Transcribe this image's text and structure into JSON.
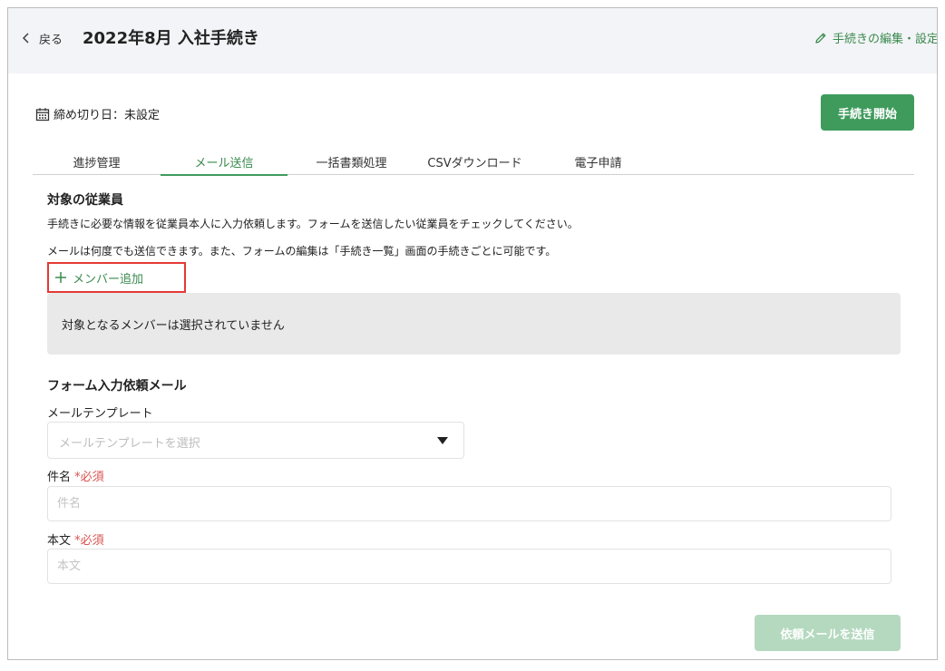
{
  "header": {
    "back_label": "戻る",
    "title": "2022年8月 入社手続き",
    "edit_link_label": "手続きの編集・設定"
  },
  "deadline": {
    "label": "締め切り日：未設定"
  },
  "start_button_label": "手続き開始",
  "tabs": [
    {
      "label": "進捗管理",
      "active": false
    },
    {
      "label": "メール送信",
      "active": true
    },
    {
      "label": "一括書類処理",
      "active": false
    },
    {
      "label": "CSVダウンロード",
      "active": false
    },
    {
      "label": "電子申請",
      "active": false
    }
  ],
  "employees": {
    "title": "対象の従業員",
    "desc1": "手続きに必要な情報を従業員本人に入力依頼します。フォームを送信したい従業員をチェックしてください。",
    "desc2": "メールは何度でも送信できます。また、フォームの編集は「手続き一覧」画面の手続きごとに可能です。",
    "add_member_label": "メンバー追加",
    "empty_message": "対象となるメンバーは選択されていません"
  },
  "mail": {
    "title": "フォーム入力依頼メール",
    "template_label": "メールテンプレート",
    "template_placeholder": "メールテンプレートを選択",
    "subject_label": "件名",
    "required_mark": "*必須",
    "subject_placeholder": "件名",
    "body_label": "本文",
    "body_placeholder": "本文",
    "send_button_label": "依頼メールを送信"
  },
  "colors": {
    "accent": "#3f9b5c",
    "accent_disabled": "#b4d9bf",
    "highlight": "#e53935",
    "required": "#d9534f",
    "header_bg": "#f3f4f7"
  },
  "icons": {
    "back": "chevron-left-icon",
    "edit": "pencil-icon",
    "calendar": "calendar-icon",
    "add": "plus-icon",
    "dropdown": "caret-down-icon"
  }
}
